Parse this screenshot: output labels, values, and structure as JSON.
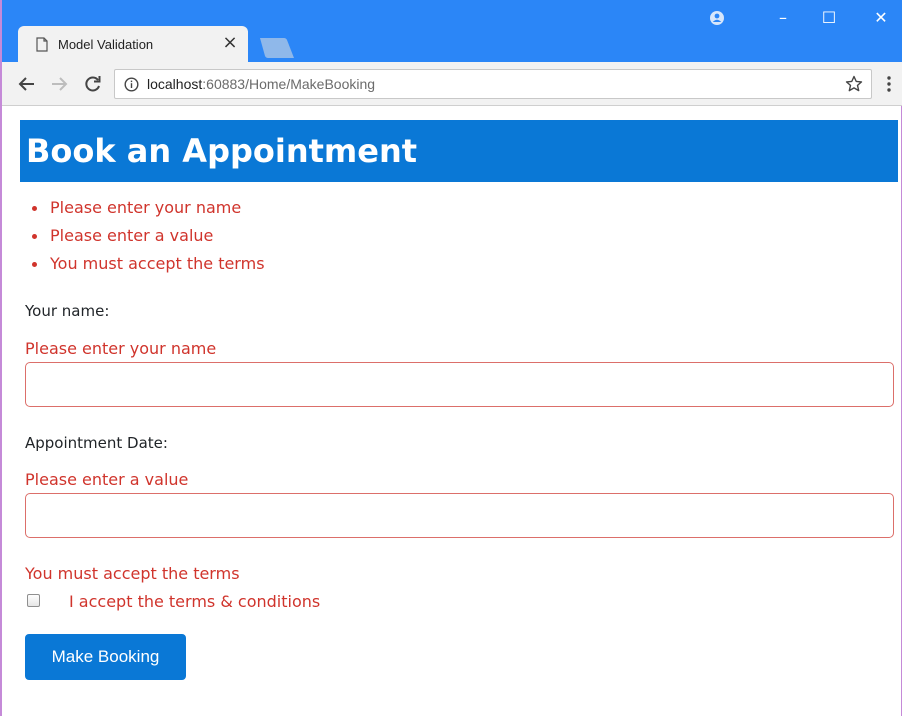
{
  "browser": {
    "tab_title": "Model Validation",
    "tab_close": "×",
    "url_host": "localhost",
    "url_path": ":60883/Home/MakeBooking",
    "window_controls": {
      "minimize": "–",
      "maximize": "☐",
      "close": "✕"
    },
    "colors": {
      "title_bar": "#2b86f7",
      "toolbar": "#f2f2f2"
    }
  },
  "page": {
    "title": "Book an Appointment",
    "header_color": "#0a78d6",
    "error_color": "#d0342c",
    "validation_summary": [
      "Please enter your name",
      "Please enter a value",
      "You must accept the terms"
    ],
    "form": {
      "name_label": "Your name:",
      "name_error": "Please enter your name",
      "name_value": "",
      "date_label": "Appointment Date:",
      "date_error": "Please enter a value",
      "date_value": "",
      "terms_error": "You must accept the terms",
      "terms_label": "I accept the terms & conditions",
      "terms_checked": false,
      "submit_label": "Make Booking"
    }
  },
  "icons": {
    "tab_page": "page-icon",
    "profile": "account-icon",
    "back": "back-arrow-icon",
    "forward": "forward-arrow-icon",
    "reload": "reload-icon",
    "info": "info-icon",
    "bookmark": "star-icon",
    "menu": "kebab-menu-icon"
  }
}
